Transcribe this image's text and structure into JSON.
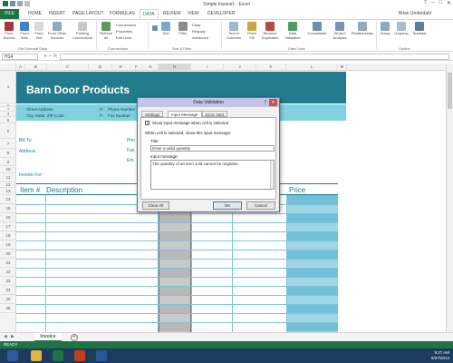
{
  "window": {
    "title": "Simple invoice1 - Excel"
  },
  "ribbon_tabs": [
    "FILE",
    "HOME",
    "INSERT",
    "PAGE LAYOUT",
    "FORMULAS",
    "DATA",
    "REVIEW",
    "VIEW",
    "DEVELOPER"
  ],
  "user": "Brian Underdahl",
  "ribbon": {
    "buttons": [
      "From Access",
      "From Web",
      "From Text",
      "From Other Sources",
      "Existing Connections",
      "Refresh All",
      "Sort",
      "Filter",
      "Text to Columns",
      "Flash Fill",
      "Remove Duplicates",
      "Data Validation",
      "Consolidate",
      "What-If Analysis",
      "Relationships",
      "Group",
      "Ungroup",
      "Subtotal"
    ],
    "small": [
      "Connections",
      "Properties",
      "Edit Links",
      "Clear",
      "Reapply",
      "Advanced"
    ],
    "groups": [
      "Get External Data",
      "Connections",
      "Sort & Filter",
      "Data Tools",
      "Outline"
    ]
  },
  "formula_bar": {
    "name_box": "H14",
    "fx": "fx",
    "value": ""
  },
  "columns": [
    "A",
    "B",
    "C",
    "D",
    "E",
    "F",
    "G",
    "H",
    "I",
    "J",
    "K",
    "L",
    "M"
  ],
  "rows": [
    "1",
    "2",
    "3",
    "4",
    "5",
    "6",
    "7",
    "8",
    "9",
    "10",
    "11",
    "12",
    "13",
    "14",
    "15",
    "16",
    "17",
    "18",
    "19",
    "20",
    "21",
    "22",
    "23",
    "24",
    "25",
    "26"
  ],
  "invoice": {
    "company": "Barn Door Products",
    "street": "Street Address",
    "city": "City, State, ZIP Code",
    "phone_label": "Phone Number",
    "fax_label": "Fax Number",
    "p_prefix": "P:",
    "f_prefix": "F:",
    "bill_to": "Bill To:",
    "address": "Address",
    "phone": "Pho",
    "fax": "Fax",
    "email": "Em",
    "invoice_for": "Invoice For:",
    "col_item": "Item #",
    "col_description": "Description",
    "col_price": "Price"
  },
  "dialog": {
    "title": "Data Validation",
    "help": "?",
    "close": "✕",
    "tabs": [
      "Settings",
      "Input Message",
      "Error Alert"
    ],
    "checkbox_label": "Show input message when cell is selected",
    "checkbox_mark": "✓",
    "intro": "When cell is selected, show this input message:",
    "title_label": "Title:",
    "title_value": "Enter a valid quantity",
    "message_label": "Input message:",
    "message_value": "The quantity of an item sold cannot be negative",
    "clear_all": "Clear All",
    "ok": "OK",
    "cancel": "Cancel"
  },
  "sheet_tab": "Invoice",
  "add_sheet": "+",
  "status": {
    "ready": "READY"
  },
  "clock": {
    "time": "9:27 AM",
    "date": "6/27/2013"
  }
}
